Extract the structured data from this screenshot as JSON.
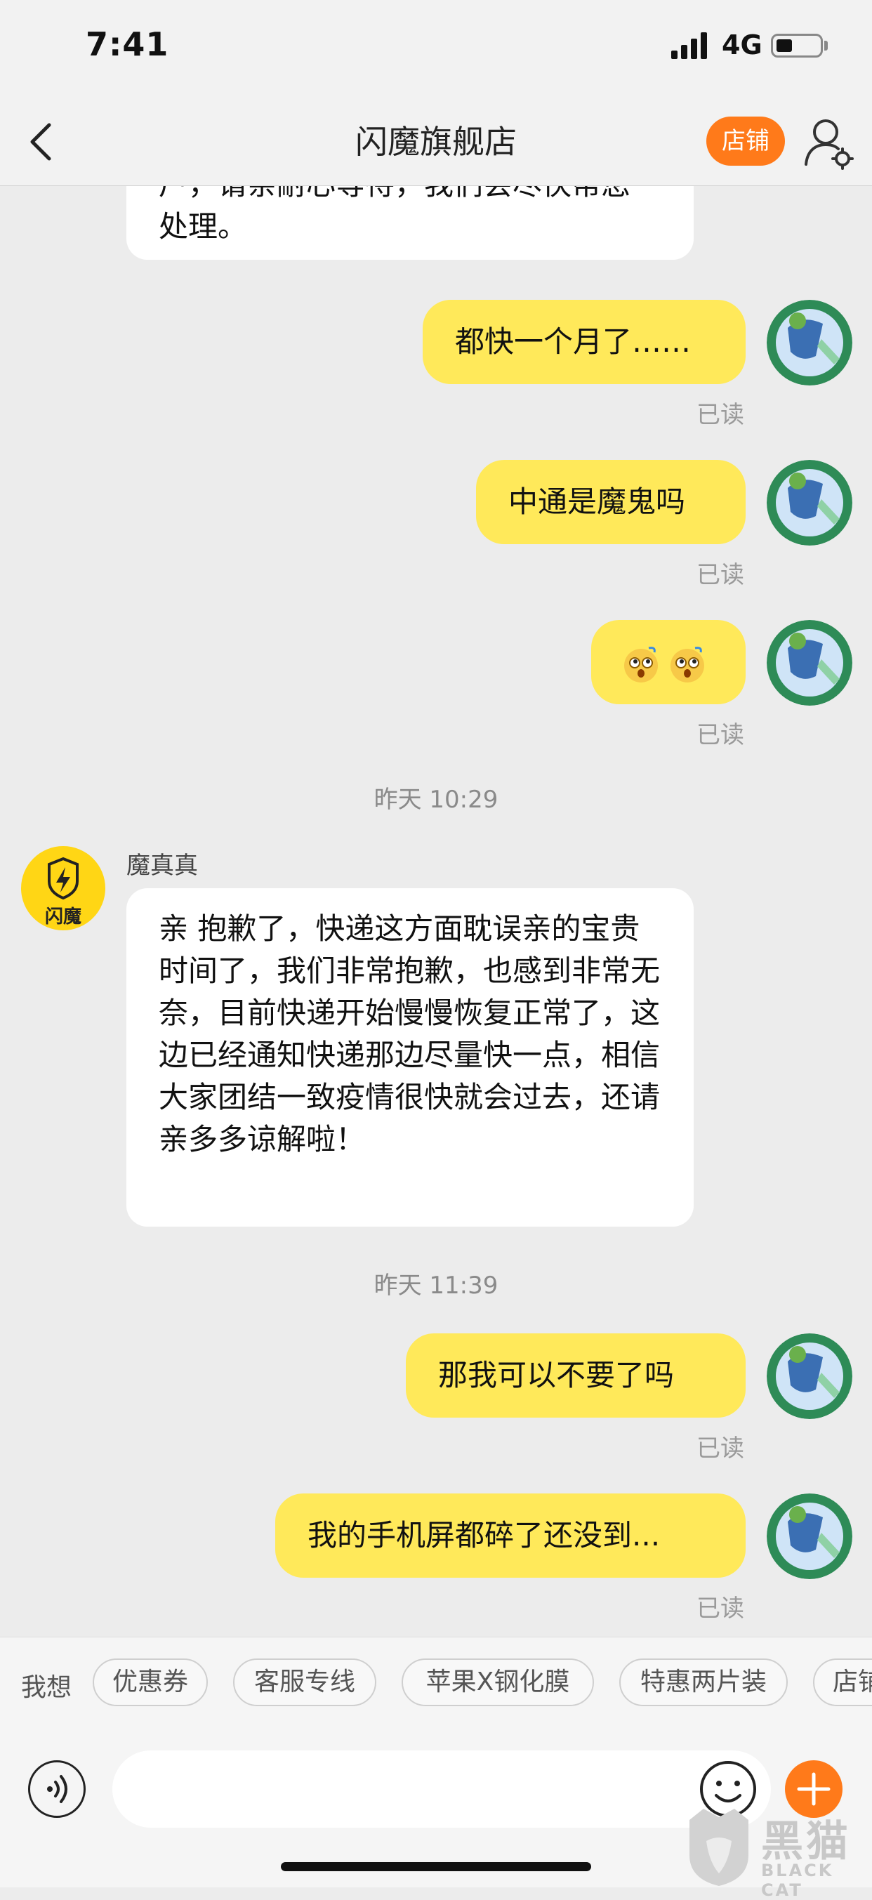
{
  "status_bar": {
    "time": "7:41",
    "network": "4G"
  },
  "nav": {
    "title": "闪魔旗舰店",
    "shop_button": "店铺"
  },
  "chat": {
    "messages": [
      {
        "side": "left",
        "text_line1": "户，请亲耐心等待，我们会尽快帮您",
        "text_line2": "处理。"
      },
      {
        "side": "right",
        "text": "都快一个月了……",
        "status": "已读"
      },
      {
        "side": "right",
        "text": "中通是魔鬼吗",
        "status": "已读"
      },
      {
        "side": "right",
        "emoji": [
          "dizzy-face-emoji",
          "dizzy-face-emoji"
        ],
        "status": "已读"
      },
      {
        "type": "timestamp",
        "text": "昨天 10:29"
      },
      {
        "side": "left",
        "sender": "魔真真",
        "avatar_text": "闪魔",
        "text": "亲 抱歉了，快递这方面耽误亲的宝贵时间了，我们非常抱歉，也感到非常无奈，目前快递开始慢慢恢复正常了，这边已经通知快递那边尽量快一点，相信大家团结一致疫情很快就会过去，还请亲多多谅解啦！"
      },
      {
        "type": "timestamp",
        "text": "昨天 11:39"
      },
      {
        "side": "right",
        "text": "那我可以不要了吗",
        "status": "已读"
      },
      {
        "side": "right",
        "text": "我的手机屏都碎了还没到...",
        "status": "已读"
      }
    ]
  },
  "quick_bar": {
    "label": "我想",
    "chips": [
      "优惠券",
      "客服专线",
      "苹果X钢化膜",
      "特惠两片装",
      "店铺"
    ]
  },
  "input": {
    "placeholder": ""
  },
  "watermark": {
    "text": "黑猫",
    "subtext": "BLACK CAT"
  },
  "colors": {
    "accent": "#ff7a1a",
    "my_bubble": "#ffe95a",
    "their_bubble": "#ffffff",
    "background": "#ececec"
  }
}
